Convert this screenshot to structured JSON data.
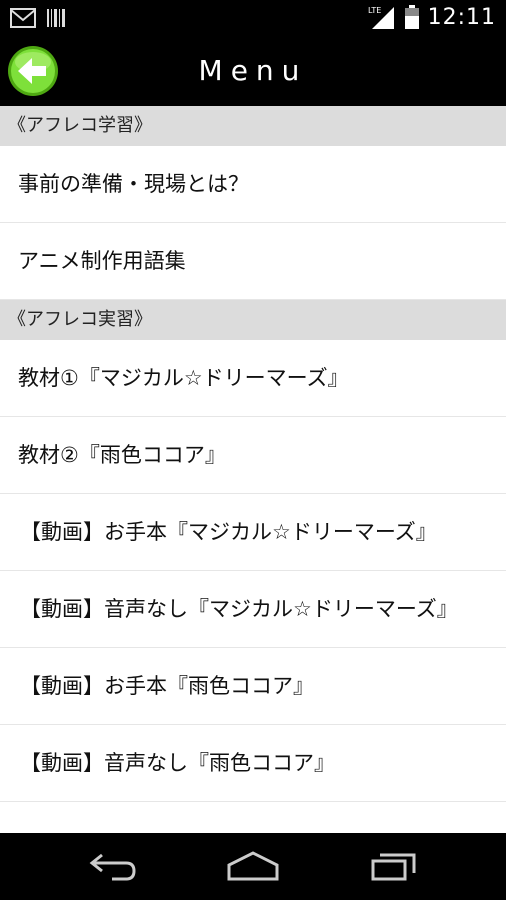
{
  "status": {
    "time": "12:11",
    "network": "LTE"
  },
  "header": {
    "title": "Menu"
  },
  "sections": [
    {
      "title": "《アフレコ学習》",
      "items": [
        {
          "label": "事前の準備・現場とは？"
        },
        {
          "label": "アニメ制作用語集"
        }
      ]
    },
    {
      "title": "《アフレコ実習》",
      "items": [
        {
          "label": "教材①『マジカル☆ドリーマーズ』"
        },
        {
          "label": "教材②『雨色ココア』"
        },
        {
          "label": "【動画】お手本『マジカル☆ドリーマーズ』"
        },
        {
          "label": "【動画】音声なし『マジカル☆ドリーマーズ』"
        },
        {
          "label": "【動画】お手本『雨色ココア』"
        },
        {
          "label": "【動画】音声なし『雨色ココア』"
        }
      ]
    }
  ],
  "colors": {
    "back_button": "#6fd21e",
    "section_bg": "#dcdcdc"
  },
  "icons": {
    "back": "arrow-left-icon",
    "nav_back": "back-icon",
    "nav_home": "home-icon",
    "nav_recents": "recents-icon"
  }
}
